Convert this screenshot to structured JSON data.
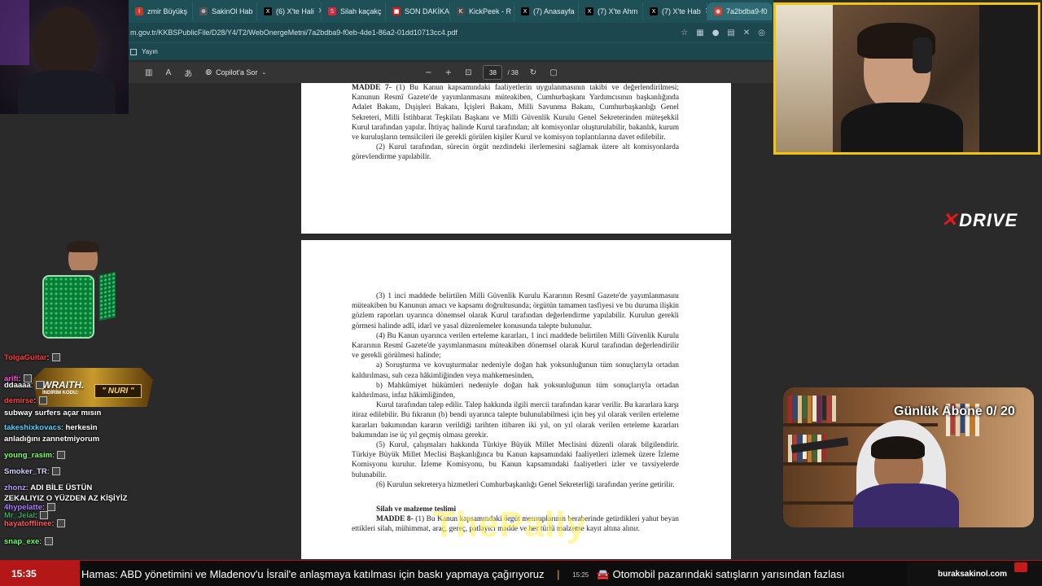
{
  "browser": {
    "tabs": [
      {
        "label": "zmir Büyükş",
        "color": "#c0392b",
        "glyph": "İ"
      },
      {
        "label": "SakinOl Hab",
        "color": "#555555",
        "glyph": "⊕"
      },
      {
        "label": "(6) X'te Hali",
        "color": "#000000",
        "glyph": "X"
      },
      {
        "label": "Silah kaçakç",
        "color": "#d7263d",
        "glyph": "S"
      },
      {
        "label": "SON DAKİKA",
        "color": "#d91a1a",
        "glyph": "■"
      },
      {
        "label": "KickPeek - R",
        "color": "#4a4a4a",
        "glyph": "K"
      },
      {
        "label": "(7) Anasayfa",
        "color": "#000000",
        "glyph": "X"
      },
      {
        "label": "(7) X'te Ahm",
        "color": "#000000",
        "glyph": "X"
      },
      {
        "label": "(7) X'te Hab",
        "color": "#000000",
        "glyph": "X"
      },
      {
        "label": "7a2bdba9-f0",
        "color": "#d43b2a",
        "glyph": "◉"
      }
    ],
    "url": "m.gov.tr/KKBSPublicFile/D28/Y4/T2/WebOnergeMetni/7a2bdba9-f0eb-4de1-86a2-01dd10713cc4.pdf",
    "favorites": {
      "label": "Yayın"
    }
  },
  "pdf_toolbar": {
    "copilot_label": "Copilot'a Sor",
    "current_page": "38",
    "total_pages": "/ 38"
  },
  "pdf": {
    "page1": [
      {
        "bold": "MADDE 7-",
        "text": " (1) Bu Kanun kapsamındaki faaliyetlerin uygulanmasının takibi ve değerlendirilmesi; Kanunun Resmî Gazete'de yayımlanmasını müteakiben, Cumhurbaşkanı Yardımcısının başkanlığında Adalet Bakanı, Dışişleri Bakanı, İçişleri Bakanı, Milli Savunma Bakanı, Cumhurbaşkanlığı Genel Sekreteri, Milli İstihbarat Teşkilatı Başkanı ve Milli Güvenlik Kurulu Genel Sekreterinden müteşekkil Kurul tarafından yapılır. İhtiyaç halinde Kurul tarafından; alt komisyonlar oluşturulabilir, bakanlık, kurum ve kuruluşların temsilcileri ile gerekli görülen kişiler Kurul ve komisyon toplantılarına davet edilebilir."
      },
      {
        "bold": "",
        "text": "(2) Kurul tarafından, sürecin örgüt nezdindeki ilerlemesini sağlamak üzere alt komisyonlarda görevlendirme yapılabilir."
      }
    ],
    "page2": [
      {
        "bold": "",
        "text": "(3) 1 inci maddede belirtilen Milli Güvenlik Kurulu Kararının Resmî Gazete'de yayımlanmasını müteakiben bu Kanunun amacı ve kapsamı doğrultusunda; örgütün tamamen tasfiyesi ve bu duruma ilişkin gözlem raporları uyarınca dönemsel olarak Kurul tarafından değerlendirme yapılabilir. Kurulun gerekli görmesi halinde adlî, idarî ve yasal düzenlemeler konusunda talepte bulunulur."
      },
      {
        "bold": "",
        "text": "(4) Bu Kanun uyarınca verilen erteleme kararları, 1 inci maddede belirtilen Milli Güvenlik Kurulu Kararının Resmî Gazete'de yayımlanmasını müteakiben dönemsel olarak Kurul tarafından değerlendirilir ve gerekli görülmesi halinde;"
      },
      {
        "bold": "",
        "text": "a) Soruşturma ve kovuşturmalar nedeniyle doğan hak yoksunluğunun tüm sonuçlarıyla ortadan kaldırılması, suh ceza hâkimliğinden veya mahkemesinden,"
      },
      {
        "bold": "",
        "text": "b) Mahkûmiyet hükümleri nedeniyle doğan hak yoksunluğunun tüm sonuçlarıyla ortadan kaldırılması, infaz hâkimliğinden,"
      },
      {
        "bold": "",
        "text": "Kurul tarafından talep edilir. Talep hakkında ilgili mercii tarafından karar verilir. Bu kararlara karşı itiraz edilebilir. Bu fıkranın (b) bendi uyarınca talepte bulunulabilmesi için beş yıl olarak verilen erteleme kararları bakımından kararın verildiği tarihten itibaren iki yıl, on yıl olarak verilen erteleme kararları bakımından ise üç yıl geçmiş olması gerekir."
      },
      {
        "bold": "",
        "text": "(5) Kurul, çalışmaları hakkında Türkiye Büyük Millet Meclisini düzenli olarak bilgilendirir. Türkiye Büyük Millet Meclisi Başkanlığınca bu Kanun kapsamındaki faaliyetleri izlemek üzere İzleme Komisyonu kurulur. İzleme Komisyonu, bu Kanun kapsamındaki faaliyetleri izler ve tavsiyelerde bulunabilir."
      },
      {
        "bold": "",
        "text": "(6) Kurulun sekreterya hizmetleri Cumhurbaşkanlığı Genel Sekreterliği tarafından yerine getirilir."
      },
      {
        "bold": "Silah ve malzeme teslimi",
        "text": ""
      },
      {
        "bold": "MADDE 8-",
        "text": " (1) Bu Kanun kapsamındaki örgüt mensuplarının beraberinde getirdikleri yahut beyan ettikleri silah, mühimmat, araç, gereç, patlayıcı madde ve her türlü malzeme kayıt altına alınır."
      }
    ],
    "watermark": "ThePally"
  },
  "overlay": {
    "brand": "DRIVE",
    "sub_counter": "Günlük Abone 0/ 20",
    "promo": {
      "title": "WRAITH.",
      "code_label": "İNDİRİM KODU:",
      "code": "\" NURI \""
    }
  },
  "chat": [
    {
      "user": "TolgaGuitar",
      "ucolor": "#ff3b3b",
      "text": ""
    },
    {
      "user": "arifi",
      "ucolor": "#ff4fd8",
      "text": ""
    },
    {
      "user": "ddaaaa",
      "ucolor": "#ffffff",
      "text": ""
    },
    {
      "user": "demirse",
      "ucolor": "#ff4040",
      "text": ""
    },
    {
      "user": "",
      "ucolor": "#ffffff",
      "text": "subway surfers açar mısın"
    },
    {
      "user": "takeshixkovacs",
      "ucolor": "#53d2ff",
      "text": "herkesin"
    },
    {
      "user": "",
      "ucolor": "#ffffff",
      "text": "anladığını zannetmiyorum"
    },
    {
      "user": "young_rasim",
      "ucolor": "#7dff6b",
      "text": ""
    },
    {
      "user": "Smoker_TR",
      "ucolor": "#d6d6ff",
      "text": ""
    },
    {
      "user": "zhonz",
      "ucolor": "#b9a0ff",
      "text": "ADI BİLE ÜSTÜN"
    },
    {
      "user": "",
      "ucolor": "#ffffff",
      "text": "ZEKALIYIZ O YÜZDEN AZ KİŞİYİZ"
    },
    {
      "user": "4hypelatte",
      "ucolor": "#a87bff",
      "text": ""
    },
    {
      "user": "Mr_Jelal",
      "ucolor": "#3aa65e",
      "text": ""
    },
    {
      "user": "hayatofflinee",
      "ucolor": "#ff5a5a",
      "text": ""
    },
    {
      "user": "snap_exe",
      "ucolor": "#6aff6a",
      "text": ""
    }
  ],
  "ticker": {
    "clock": "15:35",
    "headline1": "Hamas: ABD yönetimini ve Mladenov'u İsrail'e anlaşmaya katılması için baskı yapmaya çağırıyoruz",
    "time2": "15:25",
    "headline2": "Otomobil pazarındaki satışların yarısından fazlası",
    "site": "buraksakinol.com"
  }
}
